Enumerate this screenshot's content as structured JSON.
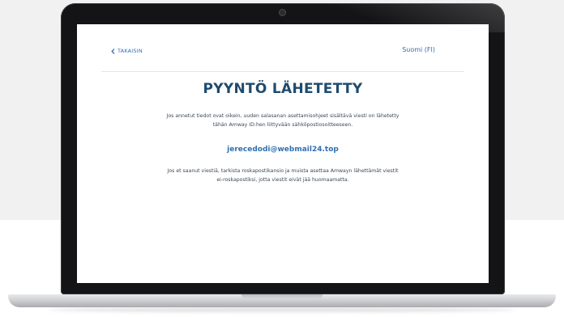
{
  "nav": {
    "back_label": "TAKAISIN",
    "language_label": "Suomi (FI)"
  },
  "main": {
    "title": "PYYNTÖ LÄHETETTY",
    "paragraph_1_line_1": "Jos annetut tiedot ovat oikein, uuden salasanan asettamisohjeet sisältävä viesti on lähetetty",
    "paragraph_1_line_2": "tähän Amway ID:hen liittyvään sähköpostiosoitteeseen.",
    "email": "jerecedodi@webmail24.top",
    "paragraph_2_line_1": "Jos et saanut viestiä, tarkista roskapostikansio ja muista asettaa Amwayn lähettämät viestit",
    "paragraph_2_line_2": "ei-roskapostiksi, jotta viestit eivät jää huomaamatta."
  },
  "colors": {
    "title": "#1f4a6e",
    "link": "#2f6fb0",
    "body_text": "#3b4856",
    "bezel": "#141416"
  },
  "icons": {
    "back": "chevron-left-icon",
    "camera": "camera-icon"
  }
}
